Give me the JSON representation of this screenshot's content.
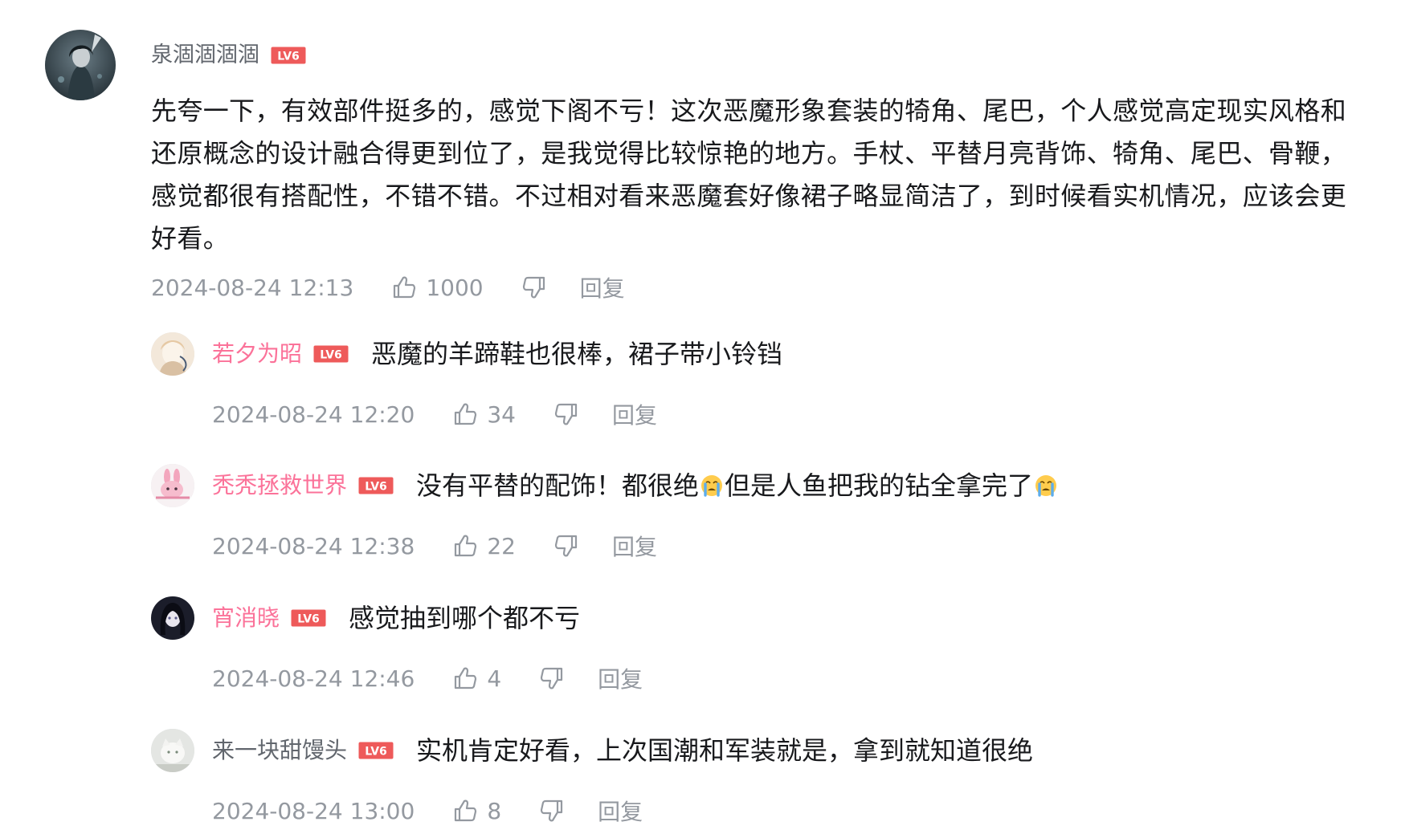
{
  "main_comment": {
    "username": "泉涸涸涸涸",
    "level_badge": "LV6",
    "avatar_icon": "user-avatar-dark-character",
    "text": "先夸一下，有效部件挺多的，感觉下阁不亏！这次恶魔形象套装的犄角、尾巴，个人感觉高定现实风格和还原概念的设计融合得更到位了，是我觉得比较惊艳的地方。手杖、平替月亮背饰、犄角、尾巴、骨鞭，感觉都很有搭配性，不错不错。不过相对看来恶魔套好像裙子略显简洁了，到时候看实机情况，应该会更好看。",
    "time": "2024-08-24 12:13",
    "likes": "1000",
    "reply_label": "回复"
  },
  "replies": [
    {
      "username": "若夕为昭",
      "level_badge": "LV6",
      "name_color": "#fb7299",
      "text_parts": [
        "恶魔的羊蹄鞋也很棒，裙子带小铃铛"
      ],
      "time": "2024-08-24 12:20",
      "likes": "34",
      "reply_label": "回复"
    },
    {
      "username": "秃秃拯救世界",
      "level_badge": "LV6",
      "name_color": "#fb7299",
      "text_parts": [
        "没有平替的配饰！都很绝",
        "但是人鱼把我的钻全拿完了",
        ""
      ],
      "emoji_icon": "crying-face-emoji",
      "time": "2024-08-24 12:38",
      "likes": "22",
      "reply_label": "回复"
    },
    {
      "username": "宵消晓",
      "level_badge": "LV6",
      "name_color": "#fb7299",
      "text_parts": [
        "感觉抽到哪个都不亏"
      ],
      "time": "2024-08-24 12:46",
      "likes": "4",
      "reply_label": "回复"
    },
    {
      "username": "来一块甜馒头",
      "level_badge": "LV6",
      "name_color": "#61666d",
      "text_parts": [
        "实机肯定好看，上次国潮和军装就是，拿到就知道很绝"
      ],
      "time": "2024-08-24 13:00",
      "likes": "8",
      "reply_label": "回复"
    }
  ],
  "colors": {
    "text_primary": "#18191c",
    "text_secondary": "#61666d",
    "text_meta": "#9499a0",
    "vip_pink": "#fb7299",
    "level_red": "#ee5a5a"
  }
}
